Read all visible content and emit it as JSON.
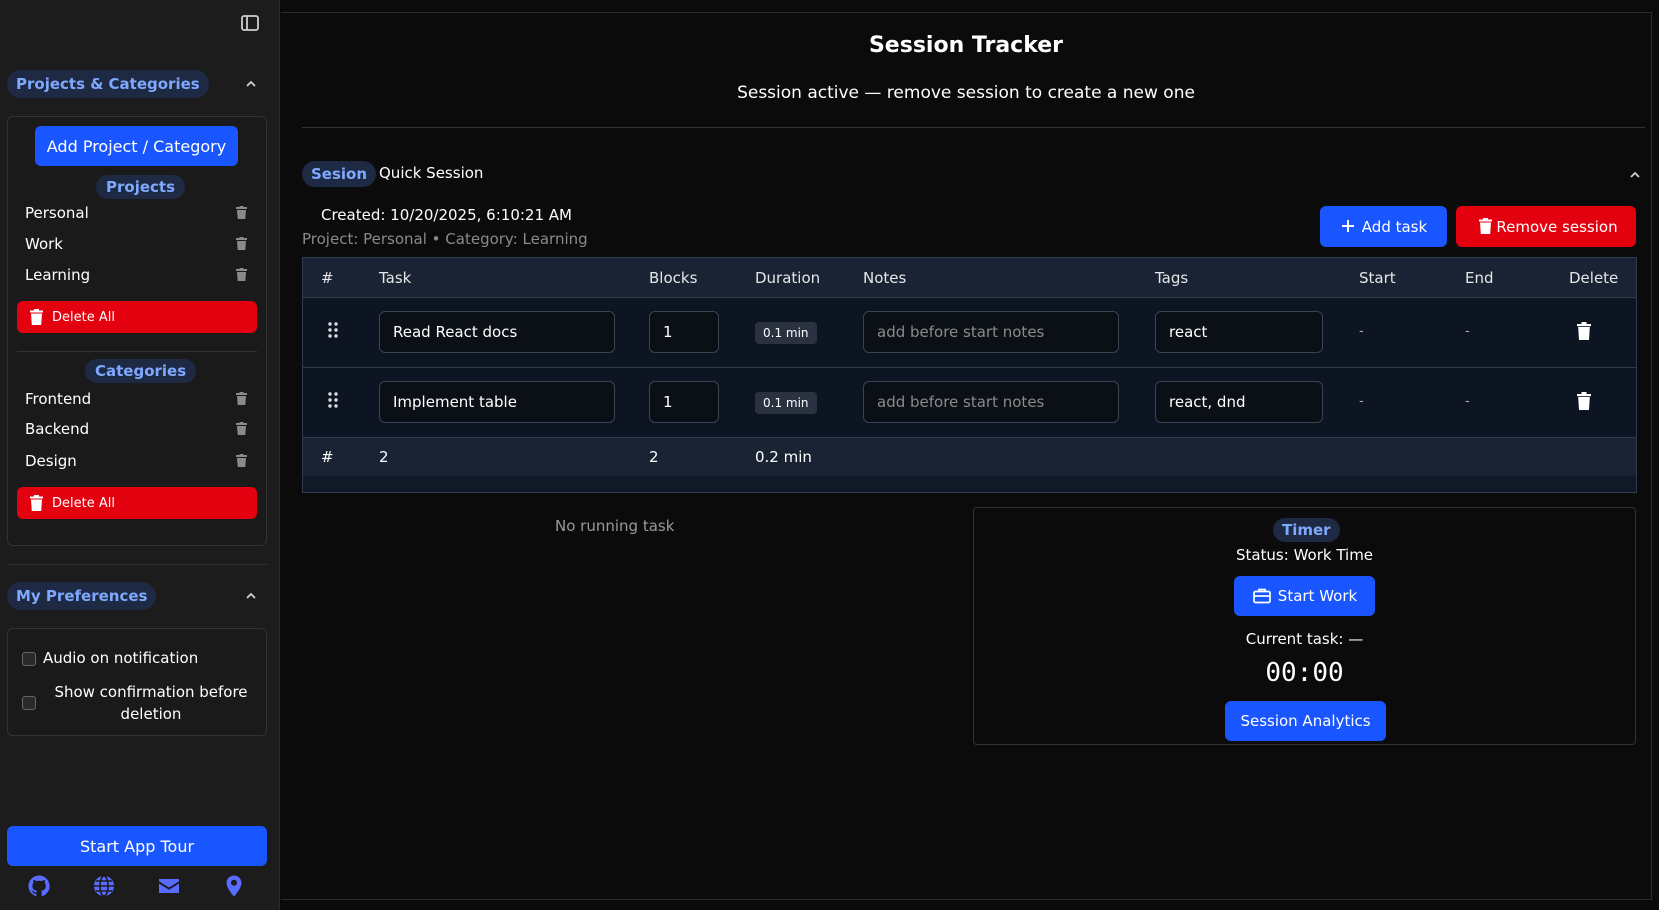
{
  "sidebar": {
    "projects_section": {
      "title": "Projects & Categories",
      "add_button": "Add Project / Category",
      "projects_label": "Projects",
      "projects": [
        "Personal",
        "Work",
        "Learning"
      ],
      "delete_all": "Delete All",
      "categories_label": "Categories",
      "categories": [
        "Frontend",
        "Backend",
        "Design"
      ],
      "delete_all_categories": "Delete All"
    },
    "preferences": {
      "title": "My Preferences",
      "audio": "Audio on notification",
      "confirm_line1": "Show confirmation before",
      "confirm_line2": "deletion"
    },
    "tour_button": "Start App Tour",
    "footer_icons": [
      "github-icon",
      "globe-icon",
      "mail-icon",
      "location-pin-icon"
    ]
  },
  "main": {
    "title": "Session Tracker",
    "subtitle": "Session active — remove session to create a new one",
    "session": {
      "badge": "Sesion",
      "name": "Quick Session",
      "created": "Created: 10/20/2025, 6:10:21 AM",
      "meta": "Project: Personal • Category: Learning",
      "add_task": "Add task",
      "remove_session": "Remove session"
    },
    "table": {
      "headers": [
        "#",
        "Task",
        "Blocks",
        "Duration",
        "Notes",
        "Tags",
        "Start",
        "End",
        "Delete"
      ],
      "rows": [
        {
          "task": "Read React docs",
          "blocks": "1",
          "duration": "0.1 min",
          "notes_placeholder": "add before start notes",
          "tags": "react",
          "start": "-",
          "end": "-"
        },
        {
          "task": "Implement table",
          "blocks": "1",
          "duration": "0.1 min",
          "notes_placeholder": "add before start notes",
          "tags": "react, dnd",
          "start": "-",
          "end": "-"
        }
      ],
      "footer": {
        "hash": "#",
        "count": "2",
        "blocks": "2",
        "duration": "0.2 min"
      }
    },
    "no_running": "No running task",
    "timer": {
      "title": "Timer",
      "status": "Status: Work Time",
      "start_work": "Start Work",
      "current_task": "Current task: —",
      "clock": "00:00",
      "analytics": "Session Analytics"
    }
  },
  "colors": {
    "accent": "#1a56ff",
    "danger": "#e3000f",
    "pill_bg": "#1e2a44",
    "pill_text": "#7fa8ff"
  }
}
